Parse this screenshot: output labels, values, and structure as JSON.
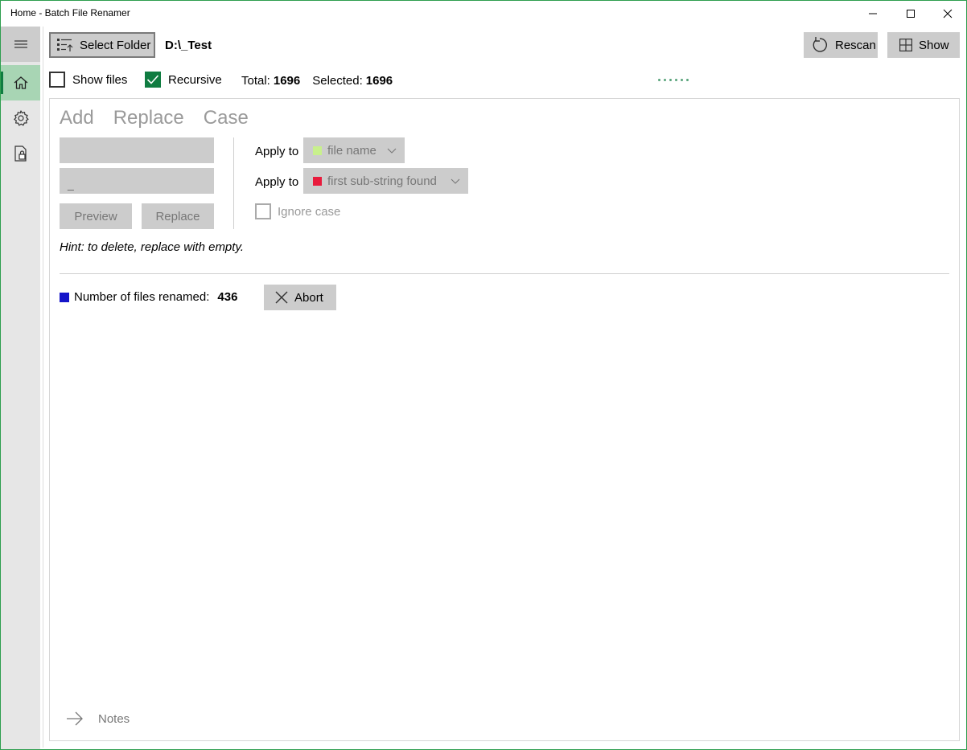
{
  "window": {
    "title": "Home - Batch File Renamer"
  },
  "sidebar": {
    "items": [
      {
        "icon": "hamburger-icon"
      },
      {
        "icon": "home-icon",
        "selected": true
      },
      {
        "icon": "gear-icon"
      },
      {
        "icon": "lock-file-icon"
      }
    ]
  },
  "toolbar": {
    "select_folder_label": "Select Folder",
    "folder_path": "D:\\_Test",
    "rescan_label": "Rescan",
    "show_label": "Show"
  },
  "options": {
    "show_files_label": "Show files",
    "show_files_checked": false,
    "recursive_label": "Recursive",
    "recursive_checked": true,
    "total_label": "Total:",
    "total_value": "1696",
    "selected_label": "Selected:",
    "selected_value": "1696"
  },
  "tabs": [
    "Add",
    "Replace",
    "Case"
  ],
  "replace_panel": {
    "find_value": "",
    "replace_value": "_",
    "preview_label": "Preview",
    "replace_label": "Replace",
    "apply_to_label_1": "Apply to",
    "apply_to_value_1": "file name",
    "apply_to_color_1": "#c8f08c",
    "apply_to_label_2": "Apply to",
    "apply_to_value_2": "first sub-string found",
    "apply_to_color_2": "#e81b3c",
    "ignore_case_label": "Ignore case",
    "ignore_case_checked": false,
    "hint": "Hint: to delete, replace with empty."
  },
  "progress": {
    "renamed_label": "Number of files renamed:",
    "renamed_count": "436",
    "indicator_color": "#1515c9",
    "abort_label": "Abort"
  },
  "notes": {
    "label": "Notes"
  },
  "colors": {
    "accent": "#107c41",
    "button_bg": "#cccccc"
  }
}
